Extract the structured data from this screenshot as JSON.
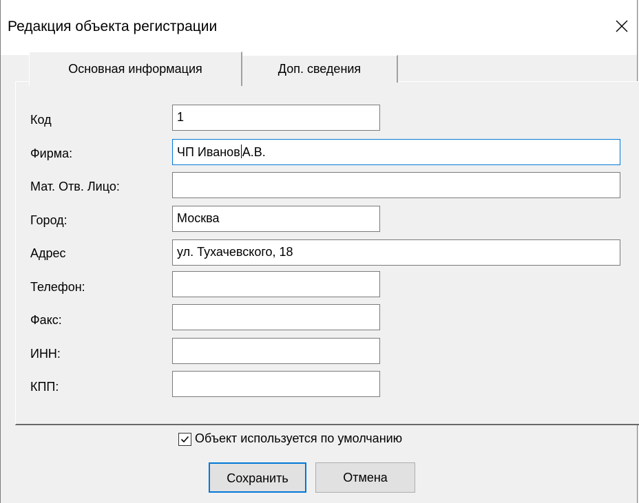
{
  "window": {
    "title": "Редакция объекта регистрации",
    "close_icon": "close-icon"
  },
  "tabs": [
    {
      "label": "Основная информация",
      "active": true
    },
    {
      "label": "Доп. сведения",
      "active": false
    }
  ],
  "form": {
    "fields": [
      {
        "key": "code",
        "label": "Код",
        "value": "1"
      },
      {
        "key": "firm",
        "label": "Фирма:",
        "value_before_caret": "ЧП Иванов",
        "value_after_caret": "А.В.",
        "focused": true
      },
      {
        "key": "responsible",
        "label": "Мат. Отв. Лицо:",
        "value": ""
      },
      {
        "key": "city",
        "label": "Город:",
        "value": "Москва"
      },
      {
        "key": "address",
        "label": "Адрес",
        "value": "ул. Тухачевского, 18"
      },
      {
        "key": "phone",
        "label": "Телефон:",
        "value": ""
      },
      {
        "key": "fax",
        "label": "Факс:",
        "value": ""
      },
      {
        "key": "inn",
        "label": "ИНН:",
        "value": ""
      },
      {
        "key": "kpp",
        "label": "КПП:",
        "value": ""
      }
    ]
  },
  "default_checkbox": {
    "label": "Объект используется по умолчанию",
    "checked": true
  },
  "buttons": {
    "save_label": "Сохранить",
    "cancel_label": "Отмена"
  },
  "colors": {
    "focus_border": "#0078d7",
    "window_bg": "#f0f0f0"
  }
}
